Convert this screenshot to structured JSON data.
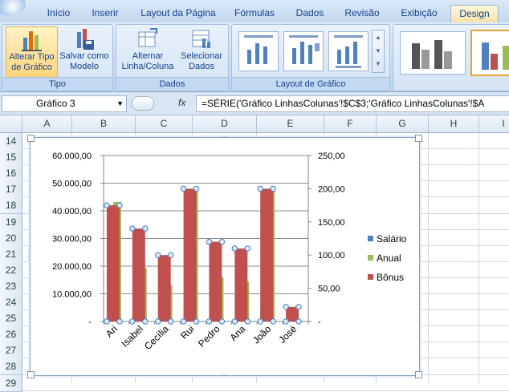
{
  "ribbon": {
    "tabs": [
      "Início",
      "Inserir",
      "Layout da Página",
      "Fórmulas",
      "Dados",
      "Revisão",
      "Exibição",
      "Design"
    ],
    "active_tab": "Design",
    "groups": {
      "tipo": {
        "label": "Tipo",
        "alterar_tipo_line1": "Alterar Tipo",
        "alterar_tipo_line2": "de Gráfico",
        "salvar_modelo_line1": "Salvar como",
        "salvar_modelo_line2": "Modelo"
      },
      "dados": {
        "label": "Dados",
        "alternar_line1": "Alternar",
        "alternar_line2": "Linha/Coluna",
        "selecionar_line1": "Selecionar",
        "selecionar_line2": "Dados"
      },
      "layout": {
        "label": "Layout de Gráfico"
      }
    }
  },
  "formula_bar": {
    "name_box": "Gráfico 3",
    "fx": "fx",
    "formula": "=SÉRIE('Gráfico LinhasColunas'!$C$3;'Gráfico LinhasColunas'!$A"
  },
  "grid": {
    "columns": [
      "A",
      "B",
      "C",
      "D",
      "E",
      "F",
      "G",
      "H",
      "I"
    ],
    "rows": [
      "14",
      "15",
      "16",
      "17",
      "18",
      "19",
      "20",
      "21",
      "22",
      "23",
      "24",
      "25",
      "26",
      "27",
      "28",
      "29"
    ]
  },
  "chart_data": {
    "type": "bar",
    "categories": [
      "Ari",
      "Isabel",
      "Cecília",
      "Rui",
      "Pedro",
      "Ana",
      "João",
      "José"
    ],
    "series": [
      {
        "name": "Salário",
        "axis": "left",
        "values": [
          3600,
          1600,
          1100,
          4000,
          1000,
          1000,
          3800,
          0
        ]
      },
      {
        "name": "Anual",
        "axis": "left",
        "values": [
          43200,
          19200,
          13200,
          48000,
          16000,
          14400,
          48000,
          0
        ]
      },
      {
        "name": "Bônus",
        "axis": "right",
        "values": [
          175,
          140,
          100,
          200,
          120,
          110,
          200,
          22
        ]
      }
    ],
    "left_axis": {
      "ylim": [
        0,
        60000
      ],
      "ticks": [
        "60.000,00",
        "50.000,00",
        "40.000,00",
        "30.000,00",
        "20.000,00",
        "10.000,00",
        "-"
      ]
    },
    "right_axis": {
      "ylim": [
        0,
        250
      ],
      "ticks": [
        "250,00",
        "200,00",
        "150,00",
        "100,00",
        "50,00",
        "-"
      ]
    },
    "legend_position": "right",
    "colors": {
      "Salário": "#4f81bd",
      "Anual": "#9bbb59",
      "Bônus": "#c0504d"
    }
  }
}
